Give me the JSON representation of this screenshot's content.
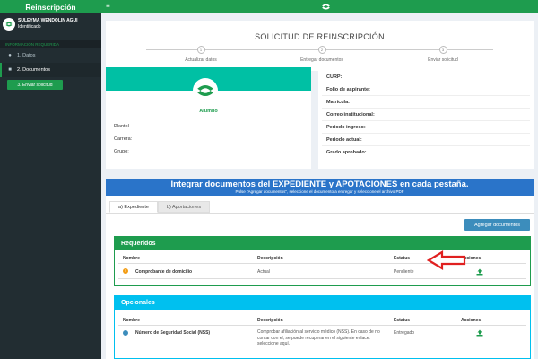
{
  "sidebar": {
    "brand": "Reinscripción",
    "user_name": "SULEYMA WENDOLIN AGUI",
    "user_status": "Identificado",
    "section_header": "INFORMACIÓN REQUERIDA",
    "items": [
      {
        "label": "1. Datos",
        "icon": "user-icon"
      },
      {
        "label": "2. Documentos",
        "icon": "folder-icon"
      }
    ],
    "send_button": "3. Enviar solicitud"
  },
  "topbar": {
    "menu_icon": "hamburger-icon",
    "logo_icon": "institution-logo-icon"
  },
  "steps": {
    "title": "SOLICITUD DE REINSCRIPCIÓN",
    "items": [
      {
        "number": "1",
        "label": "Actualizar datos"
      },
      {
        "number": "2",
        "label": "Entregar documentos"
      },
      {
        "number": "3",
        "label": "Enviar solicitud"
      }
    ]
  },
  "profile": {
    "role": "Alumno",
    "fields": [
      {
        "label": "Plantel"
      },
      {
        "label": "Carrera:"
      },
      {
        "label": "Grupo:"
      }
    ]
  },
  "info": {
    "rows": [
      "CURP:",
      "Folio de aspirante:",
      "Matrícula:",
      "Correo institucional:",
      "Periodo ingreso:",
      "Periodo actual:",
      "Grado aprobado:"
    ]
  },
  "banner": {
    "title": "Integrar documentos del EXPEDIENTE y APOTACIONES en cada pestaña.",
    "subtitle": "Pulse \"Agregar documentos\", seleccione el documento a entregar y seleccione el archivo PDF"
  },
  "tabs": [
    {
      "label": "a) Expediente",
      "active": true
    },
    {
      "label": "b) Aportaciones",
      "active": false
    }
  ],
  "add_docs_button": "Agregar documentos",
  "required": {
    "title": "Requeridos",
    "headers": {
      "name": "Nombre",
      "description": "Descripción",
      "status": "Estatus",
      "actions": "Acciones"
    },
    "rows": [
      {
        "name": "Comprobante de domicilio",
        "description": "Actual",
        "status": "Pendiente"
      }
    ]
  },
  "optional": {
    "title": "Opcionales",
    "headers": {
      "name": "Nombre",
      "description": "Descripción",
      "status": "Estatus",
      "actions": "Acciones"
    },
    "rows": [
      {
        "name": "Número de Seguridad Social (NSS)",
        "description": "Comprobar afiliación al servicio médico (NSS). En caso de no contar con el, se puede recuperar en el siguiente enlace: seleccione aquí.",
        "status": "Entregado"
      }
    ]
  },
  "colors": {
    "brand_green": "#1e9c4e",
    "sidebar_dark": "#222d32",
    "teal": "#00c0a4",
    "blue_banner": "#2a74c9",
    "info_cyan": "#00c0ef",
    "arrow_red": "#e02020"
  }
}
